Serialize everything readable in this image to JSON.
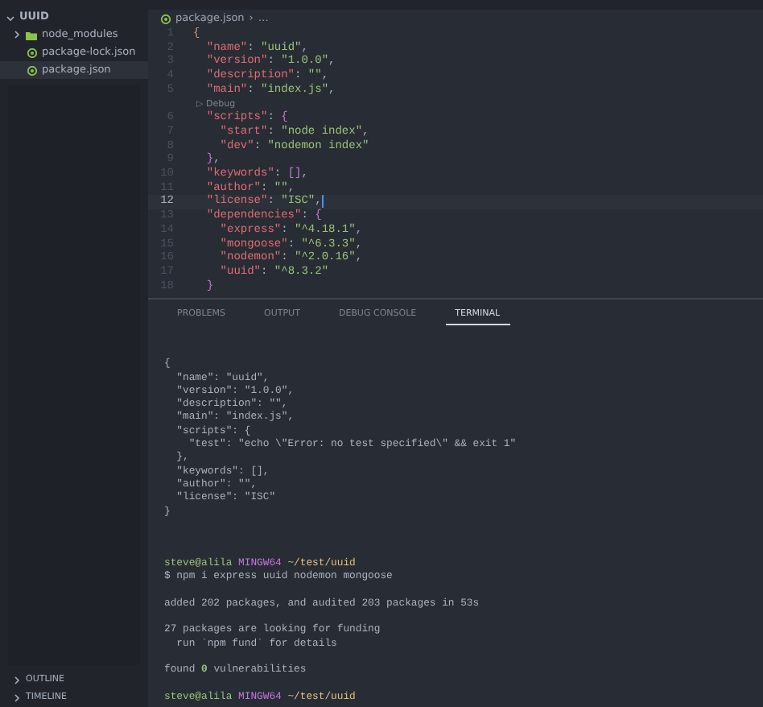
{
  "sidebar": {
    "title": "UUID",
    "expanded": true,
    "items": [
      {
        "kind": "folder",
        "label": "node_modules",
        "expanded": false,
        "selected": false
      },
      {
        "kind": "file",
        "label": "package-lock.json",
        "selected": false
      },
      {
        "kind": "file",
        "label": "package.json",
        "selected": true
      }
    ],
    "sections": [
      {
        "label": "OUTLINE",
        "expanded": false
      },
      {
        "label": "TIMELINE",
        "expanded": false
      }
    ]
  },
  "editor": {
    "breadcrumb": {
      "file": "package.json",
      "separator": "›",
      "more": "…"
    },
    "lines": [
      {
        "number": "1",
        "current": false,
        "tokens": [
          {
            "kind": "brace",
            "text": "{"
          }
        ]
      },
      {
        "number": "2",
        "current": false,
        "tokens": [
          {
            "kind": "key",
            "text": "  \"name\""
          },
          {
            "kind": "plain",
            "text": ": "
          },
          {
            "kind": "str",
            "text": "\"uuid\""
          },
          {
            "kind": "plain",
            "text": ","
          }
        ]
      },
      {
        "number": "3",
        "current": false,
        "tokens": [
          {
            "kind": "key",
            "text": "  \"version\""
          },
          {
            "kind": "plain",
            "text": ": "
          },
          {
            "kind": "str",
            "text": "\"1.0.0\""
          },
          {
            "kind": "plain",
            "text": ","
          }
        ]
      },
      {
        "number": "4",
        "current": false,
        "tokens": [
          {
            "kind": "key",
            "text": "  \"description\""
          },
          {
            "kind": "plain",
            "text": ": "
          },
          {
            "kind": "str",
            "text": "\"\""
          },
          {
            "kind": "plain",
            "text": ","
          }
        ]
      },
      {
        "number": "5",
        "current": false,
        "tokens": [
          {
            "kind": "key",
            "text": "  \"main\""
          },
          {
            "kind": "plain",
            "text": ": "
          },
          {
            "kind": "str",
            "text": "\"index.js\""
          },
          {
            "kind": "plain",
            "text": ","
          }
        ]
      },
      {
        "lens": "▷ Debug"
      },
      {
        "number": "6",
        "current": false,
        "tokens": [
          {
            "kind": "key",
            "text": "  \"scripts\""
          },
          {
            "kind": "plain",
            "text": ": "
          },
          {
            "kind": "bracket",
            "text": "{"
          }
        ]
      },
      {
        "number": "7",
        "current": false,
        "tokens": [
          {
            "kind": "key",
            "text": "    \"start\""
          },
          {
            "kind": "plain",
            "text": ": "
          },
          {
            "kind": "str",
            "text": "\"node index\""
          },
          {
            "kind": "plain",
            "text": ","
          }
        ]
      },
      {
        "number": "8",
        "current": false,
        "tokens": [
          {
            "kind": "key",
            "text": "    \"dev\""
          },
          {
            "kind": "plain",
            "text": ": "
          },
          {
            "kind": "str",
            "text": "\"nodemon index\""
          }
        ]
      },
      {
        "number": "9",
        "current": false,
        "tokens": [
          {
            "kind": "bracket",
            "text": "  }"
          },
          {
            "kind": "plain",
            "text": ","
          }
        ]
      },
      {
        "number": "10",
        "current": false,
        "tokens": [
          {
            "kind": "key",
            "text": "  \"keywords\""
          },
          {
            "kind": "plain",
            "text": ": "
          },
          {
            "kind": "bracket",
            "text": "[]"
          },
          {
            "kind": "plain",
            "text": ","
          }
        ]
      },
      {
        "number": "11",
        "current": false,
        "tokens": [
          {
            "kind": "key",
            "text": "  \"author\""
          },
          {
            "kind": "plain",
            "text": ": "
          },
          {
            "kind": "str",
            "text": "\"\""
          },
          {
            "kind": "plain",
            "text": ","
          }
        ]
      },
      {
        "number": "12",
        "current": true,
        "tokens": [
          {
            "kind": "key",
            "text": "  \"license\""
          },
          {
            "kind": "plain",
            "text": ": "
          },
          {
            "kind": "str",
            "text": "\"ISC\""
          },
          {
            "kind": "plain",
            "text": ","
          }
        ]
      },
      {
        "number": "13",
        "current": false,
        "tokens": [
          {
            "kind": "key",
            "text": "  \"dependencies\""
          },
          {
            "kind": "plain",
            "text": ": "
          },
          {
            "kind": "bracket",
            "text": "{"
          }
        ]
      },
      {
        "number": "14",
        "current": false,
        "tokens": [
          {
            "kind": "key",
            "text": "    \"express\""
          },
          {
            "kind": "plain",
            "text": ": "
          },
          {
            "kind": "str",
            "text": "\"^4.18.1\""
          },
          {
            "kind": "plain",
            "text": ","
          }
        ]
      },
      {
        "number": "15",
        "current": false,
        "tokens": [
          {
            "kind": "key",
            "text": "    \"mongoose\""
          },
          {
            "kind": "plain",
            "text": ": "
          },
          {
            "kind": "str",
            "text": "\"^6.3.3\""
          },
          {
            "kind": "plain",
            "text": ","
          }
        ]
      },
      {
        "number": "16",
        "current": false,
        "tokens": [
          {
            "kind": "key",
            "text": "    \"nodemon\""
          },
          {
            "kind": "plain",
            "text": ": "
          },
          {
            "kind": "str",
            "text": "\"^2.0.16\""
          },
          {
            "kind": "plain",
            "text": ","
          }
        ]
      },
      {
        "number": "17",
        "current": false,
        "tokens": [
          {
            "kind": "key",
            "text": "    \"uuid\""
          },
          {
            "kind": "plain",
            "text": ": "
          },
          {
            "kind": "str",
            "text": "\"^8.3.2\""
          }
        ]
      },
      {
        "number": "18",
        "current": false,
        "tokens": [
          {
            "kind": "bracket",
            "text": "  }"
          }
        ]
      }
    ]
  },
  "panel": {
    "tabs": [
      {
        "label": "PROBLEMS",
        "selected": false
      },
      {
        "label": "OUTPUT",
        "selected": false
      },
      {
        "label": "DEBUG CONSOLE",
        "selected": false
      },
      {
        "label": "TERMINAL",
        "selected": true
      }
    ],
    "terminal": [
      [
        [
          {
            "kind": "plain",
            "text": "{"
          }
        ],
        [
          {
            "kind": "plain",
            "text": "  \"name\": \"uuid\","
          }
        ],
        [
          {
            "kind": "plain",
            "text": "  \"version\": \"1.0.0\","
          }
        ],
        [
          {
            "kind": "plain",
            "text": "  \"description\": \"\","
          }
        ],
        [
          {
            "kind": "plain",
            "text": "  \"main\": \"index.js\","
          }
        ],
        [
          {
            "kind": "plain",
            "text": "  \"scripts\": {"
          }
        ],
        [
          {
            "kind": "plain",
            "text": "    \"test\": \"echo \\\"Error: no test specified\\\" && exit 1\""
          }
        ],
        [
          {
            "kind": "plain",
            "text": "  },"
          }
        ],
        [
          {
            "kind": "plain",
            "text": "  \"keywords\": [],"
          }
        ],
        [
          {
            "kind": "plain",
            "text": "  \"author\": \"\","
          }
        ],
        [
          {
            "kind": "plain",
            "text": "  \"license\": \"ISC\""
          }
        ],
        [
          {
            "kind": "plain",
            "text": "}"
          }
        ]
      ],
      [
        [
          {
            "kind": "user",
            "text": "steve@alila"
          },
          {
            "kind": "host",
            "text": " MINGW64"
          },
          {
            "kind": "path",
            "text": " ~/test/uuid"
          }
        ],
        [
          {
            "kind": "plain",
            "text": "$ npm i express uuid nodemon mongoose"
          }
        ]
      ],
      [
        [
          {
            "kind": "plain",
            "text": "added 202 packages, and audited 203 packages in 53s"
          }
        ]
      ],
      [
        [
          {
            "kind": "plain",
            "text": "27 packages are looking for funding"
          }
        ],
        [
          {
            "kind": "plain",
            "text": "  run `npm fund` for details"
          }
        ]
      ],
      [
        [
          {
            "kind": "plain",
            "text": "found "
          },
          {
            "kind": "num",
            "text": "0"
          },
          {
            "kind": "plain",
            "text": " vulnerabilities"
          }
        ]
      ],
      [
        [
          {
            "kind": "user",
            "text": "steve@alila"
          },
          {
            "kind": "host",
            "text": " MINGW64"
          },
          {
            "kind": "path",
            "text": " ~/test/uuid"
          }
        ]
      ]
    ]
  }
}
